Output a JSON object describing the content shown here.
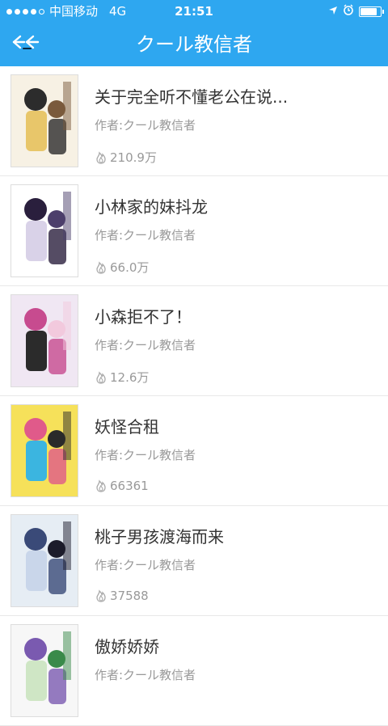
{
  "status": {
    "carrier": "中国移动",
    "network": "4G",
    "time": "21:51",
    "signal_bars": 4,
    "battery_level": 0.85
  },
  "nav": {
    "back_icon": "back-arrow-icon",
    "title": "クール教信者"
  },
  "colors": {
    "accent": "#2ea7f0",
    "text_primary": "#333333",
    "text_secondary": "#999999"
  },
  "items": [
    {
      "title": "关于完全听不懂老公在说...",
      "author": "作者:クール教信者",
      "views": "210.9万"
    },
    {
      "title": "小林家的妹抖龙",
      "author": "作者:クール教信者",
      "views": "66.0万"
    },
    {
      "title": "小森拒不了！",
      "author": "作者:クール教信者",
      "views": "12.6万"
    },
    {
      "title": "妖怪合租",
      "author": "作者:クール教信者",
      "views": "66361"
    },
    {
      "title": "桃子男孩渡海而来",
      "author": "作者:クール教信者",
      "views": "37588"
    },
    {
      "title": "傲娇娇娇",
      "author": "作者:クール教信者",
      "views": ""
    }
  ]
}
